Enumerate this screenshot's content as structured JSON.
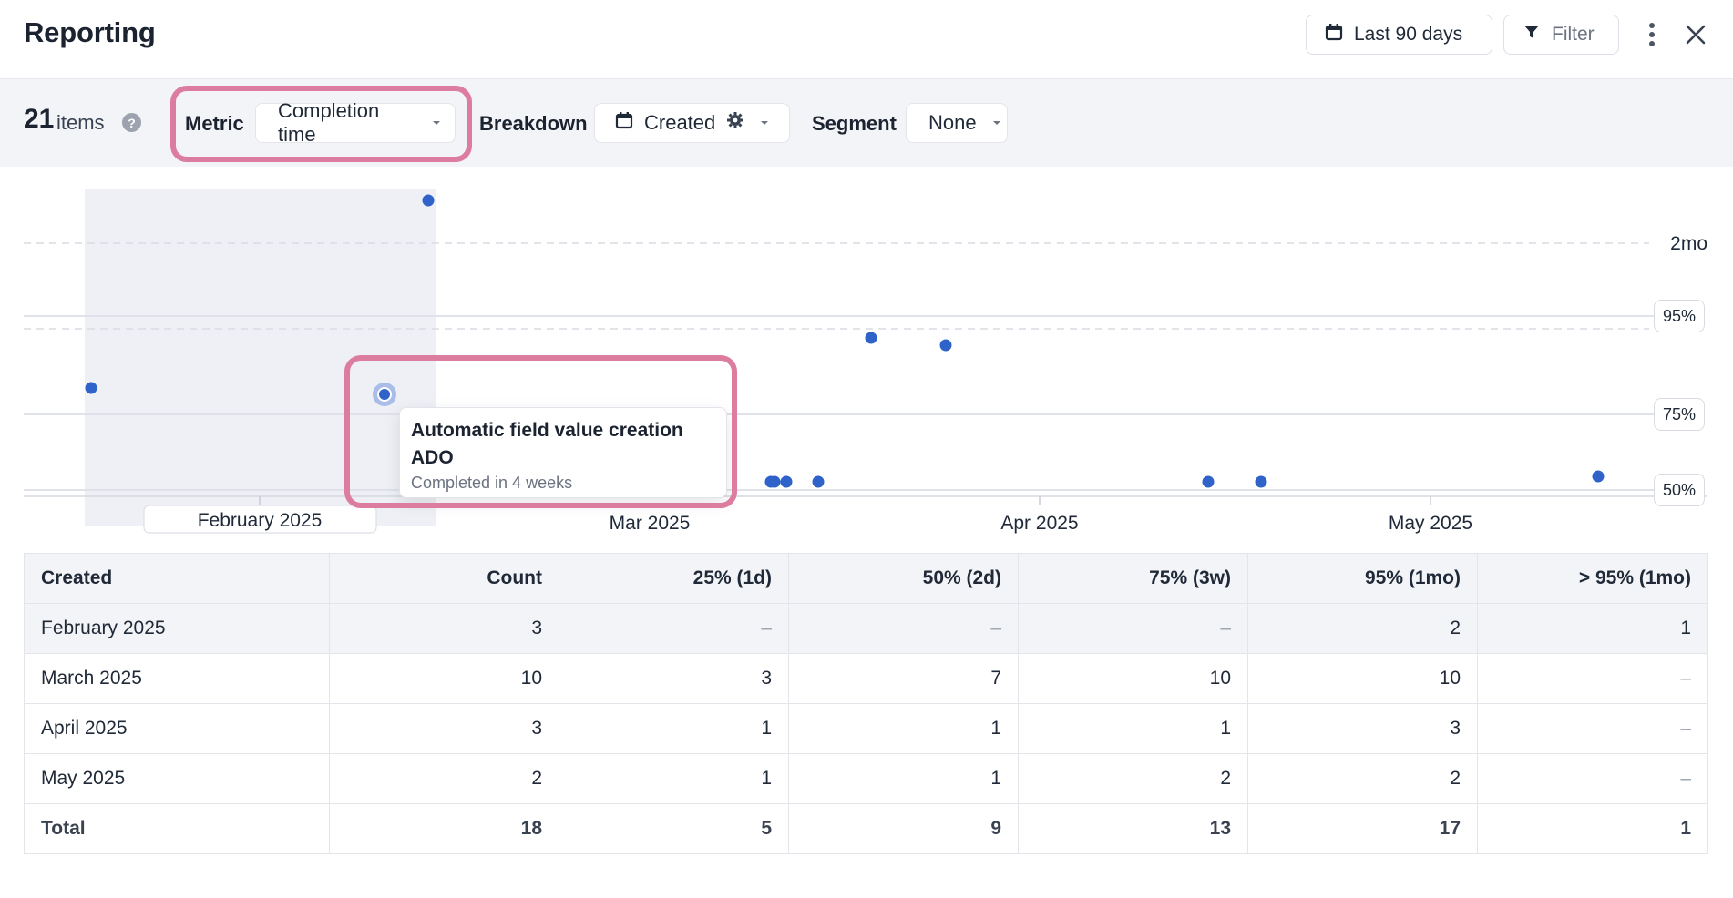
{
  "header": {
    "title": "Reporting",
    "date_range_label": "Last 90 days",
    "filter_label": "Filter",
    "icons": {
      "calendar": "calendar-icon",
      "filter": "funnel-icon",
      "more": "vertical-dots-icon",
      "close": "close-icon"
    }
  },
  "toolbar": {
    "item_count": "21",
    "item_label": "items",
    "help_glyph": "?",
    "metric_label": "Metric",
    "metric_value": "Completion time",
    "breakdown_label": "Breakdown",
    "breakdown_value": "Created",
    "segment_label": "Segment",
    "segment_value": "None"
  },
  "chart_data": {
    "type": "scatter",
    "x_tick_labels": [
      "February 2025",
      "Mar 2025",
      "Apr 2025",
      "May 2025"
    ],
    "y_tick_labels": [
      "2mo"
    ],
    "percentile_lines": [
      "95%",
      "75%",
      "50%"
    ],
    "point_color": "#2f63c9",
    "shaded_month": "February 2025"
  },
  "tooltip": {
    "title": "Automatic field value creation ADO",
    "subtitle": "Completed in 4 weeks"
  },
  "table": {
    "headers": [
      "Created",
      "Count",
      "25% (1d)",
      "50% (2d)",
      "75% (3w)",
      "95% (1mo)",
      "> 95% (1mo)"
    ],
    "rows": [
      [
        "February 2025",
        "3",
        "–",
        "–",
        "–",
        "2",
        "1"
      ],
      [
        "March 2025",
        "10",
        "3",
        "7",
        "10",
        "10",
        "–"
      ],
      [
        "April 2025",
        "3",
        "1",
        "1",
        "1",
        "3",
        "–"
      ],
      [
        "May 2025",
        "2",
        "1",
        "1",
        "2",
        "2",
        "–"
      ]
    ],
    "total": [
      "Total",
      "18",
      "5",
      "9",
      "13",
      "17",
      "1"
    ]
  }
}
